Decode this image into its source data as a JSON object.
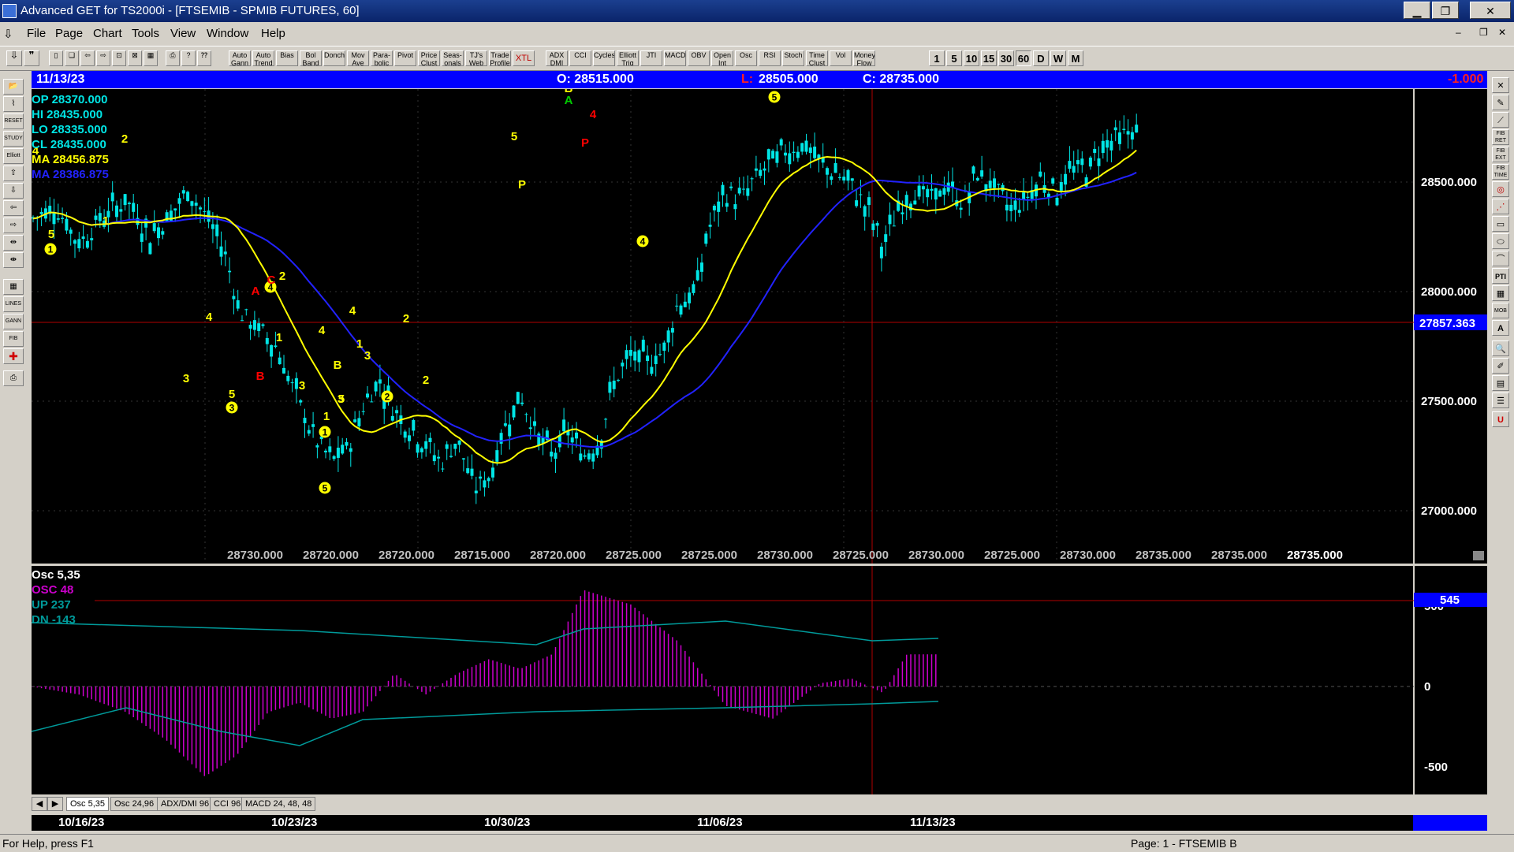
{
  "window": {
    "title": "Advanced GET for TS2000i - [FTSEMIB - SPMIB FUTURES, 60]",
    "minimize": "▁",
    "restore": "❐",
    "close": "✕"
  },
  "menu": [
    "File",
    "Page",
    "Chart",
    "Tools",
    "View",
    "Window",
    "Help"
  ],
  "toolbar": {
    "study_buttons": [
      "Auto Gann",
      "Auto Trend",
      "Bias",
      "Bol Band",
      "Donch",
      "Mov Ave",
      "Para-bolic",
      "Pivot",
      "Price Clust",
      "Seas-onals",
      "TJ's Web",
      "Trade Profile",
      "XTL",
      "ADX DMI",
      "CCI",
      "Cycles",
      "Elliott Trig",
      "JTI",
      "MACD",
      "OBV",
      "Open Int",
      "Osc",
      "RSI",
      "Stoch",
      "Time Clust",
      "Vol",
      "Money Flow"
    ],
    "timeframes": [
      "1",
      "5",
      "10",
      "15",
      "30",
      "60",
      "D",
      "W",
      "M"
    ]
  },
  "left_tools": [
    "open-icon",
    "pivot-icon",
    "reset-icon",
    "study-icon",
    "elliott-icon",
    "up-icon",
    "down-icon",
    "left-icon",
    "right-icon",
    "zoom-in-icon",
    "zoom-out-icon",
    "grid-icon",
    "lines-icon",
    "gann-icon",
    "fib-icon",
    "cross-icon",
    "print-icon"
  ],
  "right_tools": [
    "close-icon",
    "pencil-icon",
    "line-icon",
    "fib-ret-icon",
    "fib-ext-icon",
    "fib-time-icon",
    "circle-icon",
    "fan-icon",
    "box-icon",
    "ellipse-icon",
    "arc-icon",
    "pti-icon",
    "grid-icon",
    "mob-icon",
    "text-icon",
    "zoom-icon",
    "eraser-icon",
    "table-icon",
    "list-icon",
    "u-icon"
  ],
  "right_tool_labels": {
    "fib_ret": "FIB RET",
    "fib_ext": "FIB EXT",
    "fib_time": "FIB TIME",
    "pti": "PTI",
    "mob": "MOB",
    "text": "A",
    "u": "U"
  },
  "info_bar": {
    "date": "11/13/23",
    "open": "O: 28515.000",
    "low": "L: 28505.000",
    "close": "C: 28735.000",
    "change": "-1.000"
  },
  "price_legend": {
    "op": "OP  28370.000",
    "hi": "HI   28435.000",
    "lo": "LO  28335.000",
    "cl": "CL  28435.000",
    "ma1": "MA  28456.875",
    "ma2": "MA  28386.875"
  },
  "price_axis": {
    "labels": [
      "28500.000",
      "28000.000",
      "27500.000",
      "27000.000"
    ],
    "current": "27857.363"
  },
  "bottom_values": [
    "28730.000",
    "28720.000",
    "28720.000",
    "28715.000",
    "28720.000",
    "28725.000",
    "28725.000",
    "28730.000",
    "28725.000",
    "28730.000",
    "28725.000",
    "28730.000",
    "28735.000",
    "28735.000",
    "28735.000"
  ],
  "wave_labels": {
    "circled": [
      "1",
      "3",
      "4",
      "1",
      "2",
      "5",
      "3",
      "4",
      "5"
    ],
    "plain": [
      "4",
      "5",
      "1",
      "2",
      "3",
      "4",
      "5",
      "B",
      "A",
      "C",
      "2",
      "1",
      "3",
      "4",
      "1",
      "B",
      "5",
      "3",
      "4",
      "1",
      "2",
      "2",
      "3",
      "5",
      "P",
      "B",
      "A",
      "4",
      "P"
    ]
  },
  "osc_legend": {
    "title": "Osc 5,35",
    "osc": "OSC 48",
    "up": "UP   237",
    "dn": "DN   -143"
  },
  "osc_axis": {
    "labels": [
      "500",
      "0",
      "-500"
    ],
    "current": "545"
  },
  "tabs": [
    "Osc 5,35",
    "Osc 24,96",
    "ADX/DMI 96",
    "CCI 96",
    "MACD 24, 48, 48"
  ],
  "dates": [
    "10/16/23",
    "10/23/23",
    "10/30/23",
    "11/06/23",
    "11/13/23"
  ],
  "status": {
    "help": "For Help, press F1",
    "page": "Page: 1 - FTSEMIB B"
  },
  "colors": {
    "candle": "#00e5e5",
    "ma_fast": "#ffff00",
    "ma_slow": "#2222ff",
    "osc": "#cc00cc",
    "osc_band": "#009a9a",
    "wave_yellow": "#ffff00",
    "wave_red": "#ff0000",
    "wave_green": "#00cc00"
  }
}
